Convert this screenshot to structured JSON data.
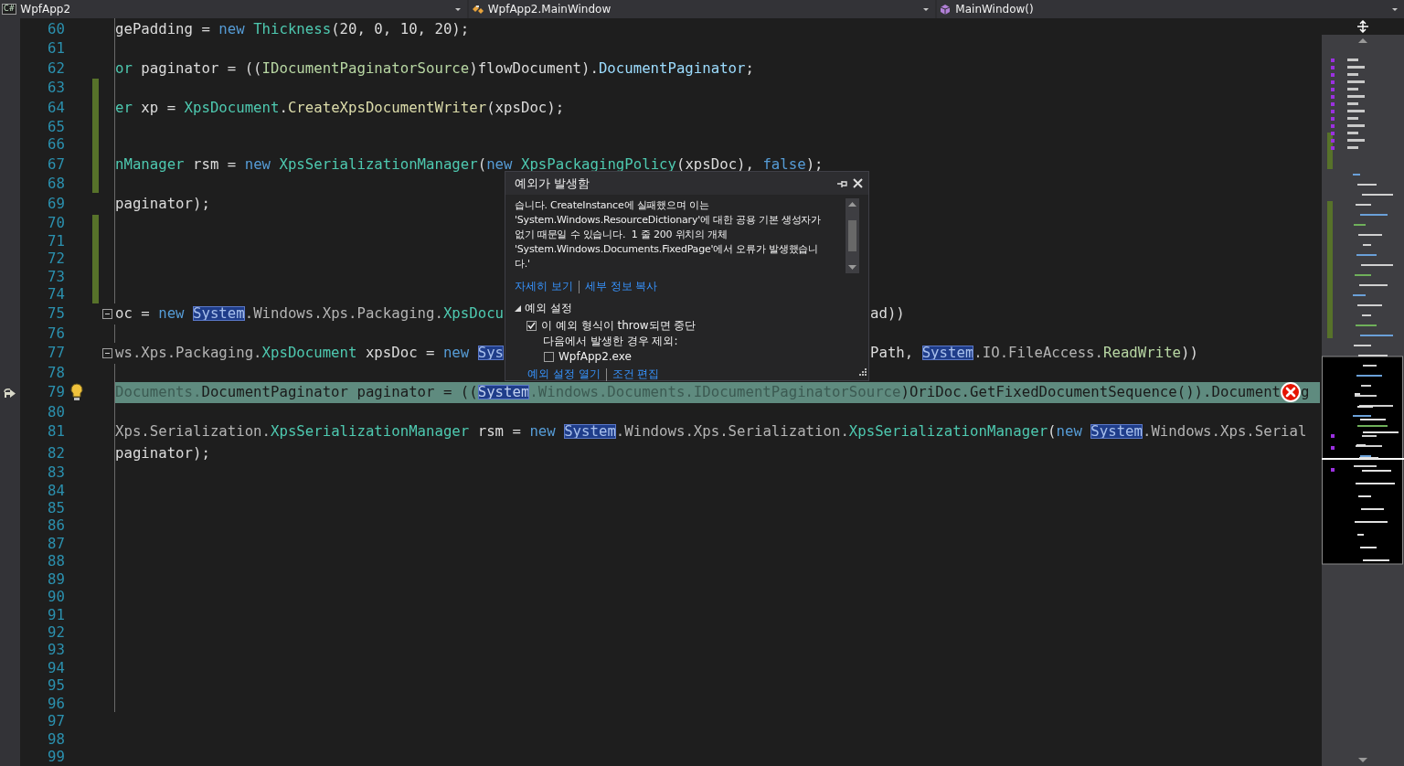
{
  "navigation_bar": [
    {
      "kind": "project",
      "icon_label": "C#",
      "label": "WpfApp2"
    },
    {
      "kind": "class",
      "label": "WpfApp2.MainWindow"
    },
    {
      "kind": "method",
      "label": "MainWindow()"
    }
  ],
  "editor": {
    "lines": [
      {
        "number": "60",
        "changed": false,
        "foldable": false,
        "current": false,
        "lightbulb": false,
        "segments": [
          {
            "kind": "plain",
            "text": "gePadding = "
          },
          {
            "kind": "keyword",
            "text": "new"
          },
          {
            "kind": "type",
            "text": " Thickness"
          },
          {
            "kind": "plain",
            "text": "(20, 0, 10, 20);"
          }
        ]
      },
      {
        "number": "61",
        "changed": false,
        "foldable": false,
        "current": false,
        "lightbulb": false
      },
      {
        "number": "62",
        "changed": false,
        "foldable": false,
        "current": false,
        "lightbulb": false,
        "segments": [
          {
            "kind": "type",
            "text": "or"
          },
          {
            "kind": "plain",
            "text": " paginator = (("
          },
          {
            "kind": "interface",
            "text": "IDocumentPaginatorSource"
          },
          {
            "kind": "plain",
            "text": ")flowDocument)."
          },
          {
            "kind": "property",
            "text": "DocumentPaginator"
          },
          {
            "kind": "plain",
            "text": ";"
          }
        ]
      },
      {
        "number": "63",
        "changed": true,
        "foldable": false,
        "current": false,
        "lightbulb": false
      },
      {
        "number": "64",
        "changed": true,
        "foldable": false,
        "current": false,
        "lightbulb": false,
        "segments": [
          {
            "kind": "type",
            "text": "er"
          },
          {
            "kind": "plain",
            "text": " xp = "
          },
          {
            "kind": "type",
            "text": "XpsDocument"
          },
          {
            "kind": "plain",
            "text": "."
          },
          {
            "kind": "method",
            "text": "CreateXpsDocumentWriter"
          },
          {
            "kind": "plain",
            "text": "(xpsDoc);"
          }
        ]
      },
      {
        "number": "65",
        "changed": true,
        "foldable": false,
        "current": false,
        "lightbulb": false
      },
      {
        "number": "66",
        "changed": true,
        "foldable": false,
        "current": false,
        "lightbulb": false
      },
      {
        "number": "67",
        "changed": true,
        "foldable": false,
        "current": false,
        "lightbulb": false,
        "segments": [
          {
            "kind": "type",
            "text": "nManager"
          },
          {
            "kind": "plain",
            "text": " rsm = "
          },
          {
            "kind": "keyword",
            "text": "new"
          },
          {
            "kind": "type",
            "text": " XpsSerializationManager"
          },
          {
            "kind": "plain",
            "text": "("
          },
          {
            "kind": "keyword",
            "text": "new"
          },
          {
            "kind": "type",
            "text": " XpsPackagingPolicy"
          },
          {
            "kind": "plain",
            "text": "(xpsDoc), "
          },
          {
            "kind": "keyword",
            "text": "false"
          },
          {
            "kind": "plain",
            "text": ");"
          }
        ]
      },
      {
        "number": "68",
        "changed": true,
        "foldable": false,
        "current": false,
        "lightbulb": false
      },
      {
        "number": "69",
        "changed": false,
        "foldable": false,
        "current": false,
        "lightbulb": false,
        "segments": [
          {
            "kind": "plain",
            "text": "paginator);"
          }
        ]
      },
      {
        "number": "70",
        "changed": true,
        "foldable": false,
        "current": false,
        "lightbulb": false
      },
      {
        "number": "71",
        "changed": true,
        "foldable": false,
        "current": false,
        "lightbulb": false
      },
      {
        "number": "72",
        "changed": true,
        "foldable": false,
        "current": false,
        "lightbulb": false
      },
      {
        "number": "73",
        "changed": true,
        "foldable": false,
        "current": false,
        "lightbulb": false
      },
      {
        "number": "74",
        "changed": true,
        "foldable": false,
        "current": false,
        "lightbulb": false
      },
      {
        "number": "75",
        "changed": false,
        "foldable": true,
        "current": false,
        "lightbulb": false,
        "segments": [
          {
            "kind": "plain",
            "text": "oc = "
          },
          {
            "kind": "keyword",
            "text": "new "
          },
          {
            "kind": "match",
            "text": "System"
          },
          {
            "kind": "namespace",
            "text": ".Windows.Xps.Packaging."
          },
          {
            "kind": "type",
            "text": "XpsDocu"
          }
        ],
        "tail": [
          {
            "kind": "plain",
            "text": "ad))"
          }
        ]
      },
      {
        "number": "76",
        "changed": false,
        "foldable": false,
        "current": false,
        "lightbulb": false
      },
      {
        "number": "77",
        "changed": false,
        "foldable": true,
        "current": false,
        "lightbulb": false,
        "segments": [
          {
            "kind": "namespace",
            "text": "ws.Xps.Packaging."
          },
          {
            "kind": "type",
            "text": "XpsDocument"
          },
          {
            "kind": "plain",
            "text": " xpsDoc = "
          },
          {
            "kind": "keyword",
            "text": "new "
          },
          {
            "kind": "match",
            "text": "Sys"
          }
        ],
        "tail": [
          {
            "kind": "plain",
            "text": "Path, "
          },
          {
            "kind": "match",
            "text": "System"
          },
          {
            "kind": "namespace",
            "text": ".IO.FileAccess."
          },
          {
            "kind": "enum",
            "text": "ReadWrite"
          },
          {
            "kind": "plain",
            "text": "))"
          }
        ]
      },
      {
        "number": "78",
        "changed": false,
        "foldable": false,
        "current": false,
        "lightbulb": false
      },
      {
        "number": "79",
        "changed": false,
        "foldable": false,
        "current": true,
        "lightbulb": true,
        "segments": [
          {
            "kind": "namespace",
            "text": "Documents."
          },
          {
            "kind": "type",
            "text": "DocumentPaginator"
          },
          {
            "kind": "plain",
            "text": " paginator = (("
          },
          {
            "kind": "match",
            "text": "System"
          },
          {
            "kind": "namespace",
            "text": ".Windows.Documents.IDocumentPaginatorSource"
          },
          {
            "kind": "plain",
            "text": ")OriDoc.GetFixedDocumentSequence()).Document"
          },
          {
            "kind": "error"
          },
          {
            "kind": "plain",
            "text": "g"
          }
        ]
      },
      {
        "number": "80",
        "changed": false,
        "foldable": false,
        "current": false,
        "lightbulb": false
      },
      {
        "number": "81",
        "changed": false,
        "foldable": false,
        "current": false,
        "lightbulb": false,
        "segments": [
          {
            "kind": "namespace",
            "text": "Xps.Serialization."
          },
          {
            "kind": "type",
            "text": "XpsSerializationManager"
          },
          {
            "kind": "plain",
            "text": " rsm = "
          },
          {
            "kind": "keyword",
            "text": "new "
          },
          {
            "kind": "match",
            "text": "System"
          },
          {
            "kind": "namespace",
            "text": ".Windows.Xps.Serialization."
          },
          {
            "kind": "type",
            "text": "XpsSerializationManager"
          },
          {
            "kind": "plain",
            "text": "("
          },
          {
            "kind": "keyword",
            "text": "new "
          },
          {
            "kind": "match",
            "text": "System"
          },
          {
            "kind": "namespace",
            "text": ".Windows.Xps.Serial"
          }
        ]
      },
      {
        "number": "82",
        "changed": false,
        "foldable": false,
        "current": false,
        "lightbulb": false,
        "segments": [
          {
            "kind": "plain",
            "text": "paginator);"
          }
        ]
      },
      {
        "number": "83",
        "changed": false,
        "foldable": false,
        "current": false,
        "lightbulb": false
      },
      {
        "number": "84",
        "changed": false,
        "foldable": false,
        "current": false,
        "lightbulb": false
      },
      {
        "number": "85",
        "changed": false,
        "foldable": false,
        "current": false,
        "lightbulb": false
      },
      {
        "number": "86",
        "changed": false,
        "foldable": false,
        "current": false,
        "lightbulb": false
      },
      {
        "number": "87",
        "changed": false,
        "foldable": false,
        "current": false,
        "lightbulb": false
      },
      {
        "number": "88",
        "changed": false,
        "foldable": false,
        "current": false,
        "lightbulb": false
      },
      {
        "number": "89",
        "changed": false,
        "foldable": false,
        "current": false,
        "lightbulb": false
      },
      {
        "number": "90",
        "changed": false,
        "foldable": false,
        "current": false,
        "lightbulb": false
      },
      {
        "number": "91",
        "changed": false,
        "foldable": false,
        "current": false,
        "lightbulb": false
      },
      {
        "number": "92",
        "changed": false,
        "foldable": false,
        "current": false,
        "lightbulb": false
      },
      {
        "number": "93",
        "changed": false,
        "foldable": false,
        "current": false,
        "lightbulb": false
      },
      {
        "number": "94",
        "changed": false,
        "foldable": false,
        "current": false,
        "lightbulb": false
      },
      {
        "number": "95",
        "changed": false,
        "foldable": false,
        "current": false,
        "lightbulb": false
      },
      {
        "number": "96",
        "changed": false,
        "foldable": false,
        "current": false,
        "lightbulb": false
      },
      {
        "number": "97",
        "changed": false,
        "foldable": false,
        "current": false,
        "lightbulb": false
      },
      {
        "number": "98",
        "changed": false,
        "foldable": false,
        "current": false,
        "lightbulb": false
      },
      {
        "number": "99",
        "changed": false,
        "foldable": false,
        "current": false,
        "lightbulb": false
      }
    ]
  },
  "exception_popup": {
    "title": "예외가 발생함",
    "message": "습니다. CreateInstance에 실패했으며 이는\n'System.Windows.ResourceDictionary'에 대한 공용 기본 생성자가\n없기 때문일 수 있습니다.  1 줄 200 위치의 개체\n'System.Windows.Documents.FixedPage'에서 오류가 발생했습니\n다.'",
    "links": [
      "자세히 보기",
      "세부 정보 복사"
    ],
    "settings": {
      "label": "예외 설정",
      "expanded": true,
      "options": [
        {
          "kind": "checkbox",
          "label": "이 예외 형식이 throw되면 중단",
          "checked": true
        },
        {
          "kind": "label",
          "label": "다음에서 발생한 경우 제외:"
        },
        {
          "kind": "checkbox",
          "label": "WpfApp2.exe",
          "checked": false
        }
      ]
    },
    "footer_links": [
      "예외 설정 열기",
      "조건 편집"
    ]
  }
}
